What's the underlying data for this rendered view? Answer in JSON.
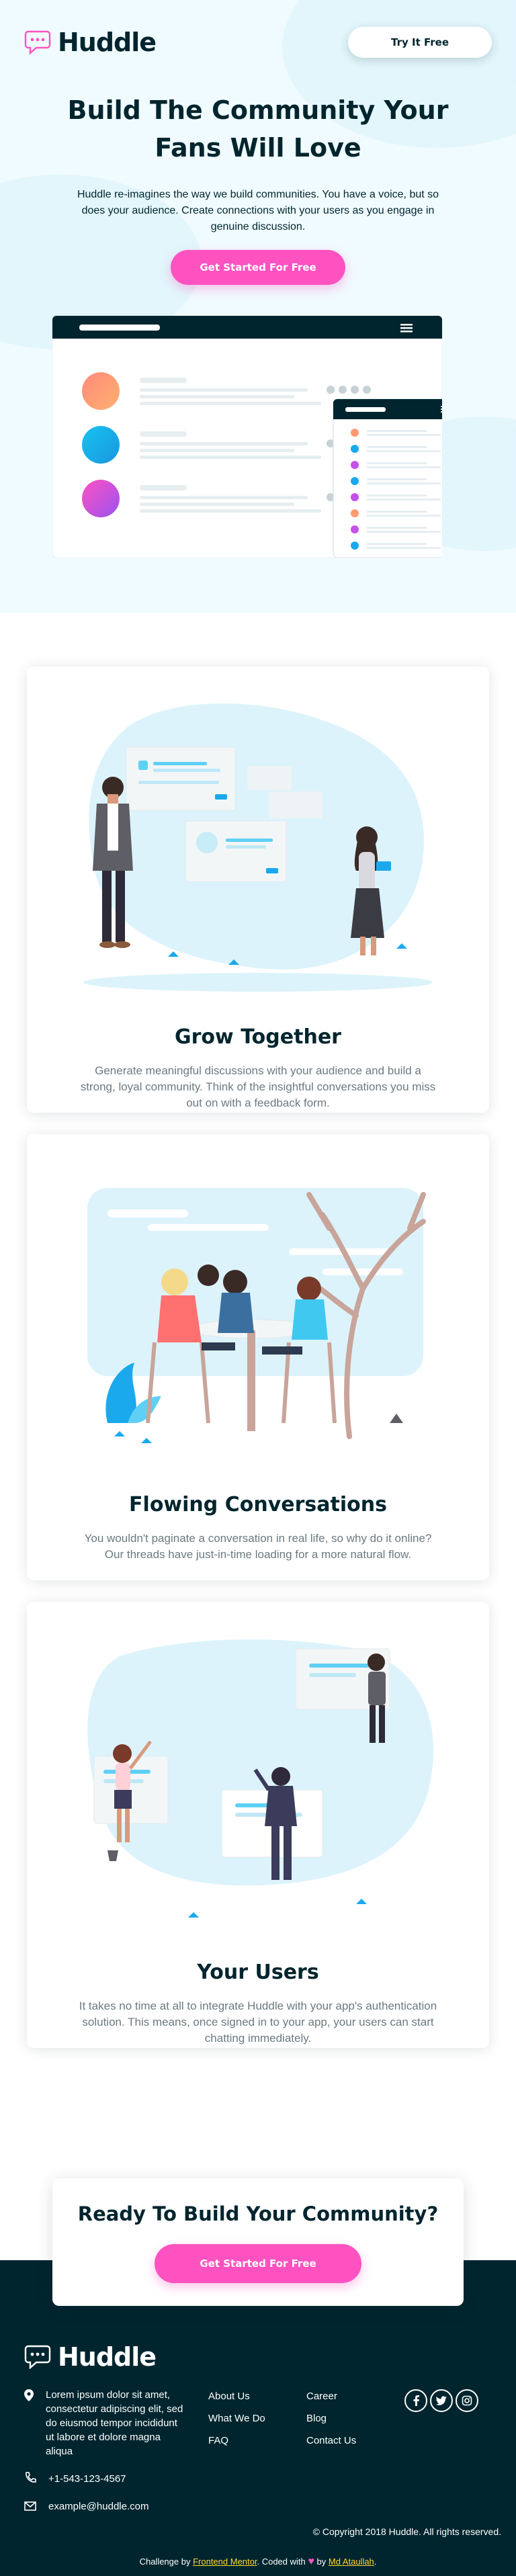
{
  "header": {
    "logo_text": "Huddle",
    "try_button": "Try It Free"
  },
  "hero": {
    "title": "Build The Community Your Fans Will Love",
    "subtitle": "Huddle re-imagines the way we build communities. You have a voice, but so does your audience. Create connections with your users as you engage in genuine discussion.",
    "cta": "Get Started For Free"
  },
  "features": [
    {
      "title": "Grow Together",
      "text": "Generate meaningful discussions with your audience and build a strong, loyal community. Think of the insightful conversations you miss out on with a feedback form."
    },
    {
      "title": "Flowing Conversations",
      "text": "You wouldn't paginate a conversation in real life, so why do it online? Our threads have just-in-time loading for a more natural flow."
    },
    {
      "title": "Your Users",
      "text": "It takes no time at all to integrate Huddle with your app's authentication solution. This means, once signed in to your app, your users can start chatting immediately."
    }
  ],
  "cta_section": {
    "title": "Ready To Build Your Community?",
    "button": "Get Started For Free"
  },
  "footer": {
    "logo_text": "Huddle",
    "address": "Lorem ipsum dolor sit amet, consectetur adipiscing elit, sed do eiusmod tempor incididunt ut labore et dolore magna aliqua",
    "phone": "+1-543-123-4567",
    "email": "example@huddle.com",
    "links_col1": [
      "About Us",
      "What We Do",
      "FAQ"
    ],
    "links_col2": [
      "Career",
      "Blog",
      "Contact Us"
    ],
    "copyright": "© Copyright 2018 Huddle. All rights reserved.",
    "attribution": {
      "prefix": "Challenge by",
      "fm": "Frontend Mentor",
      "coded": ". Coded with",
      "by": "by",
      "author": "Md Ataullah",
      "suffix": "."
    }
  },
  "colors": {
    "accent": "#ff52c1",
    "dark": "#00252e",
    "hero_bg": "#f0fbff",
    "link": "#ffd92e"
  }
}
